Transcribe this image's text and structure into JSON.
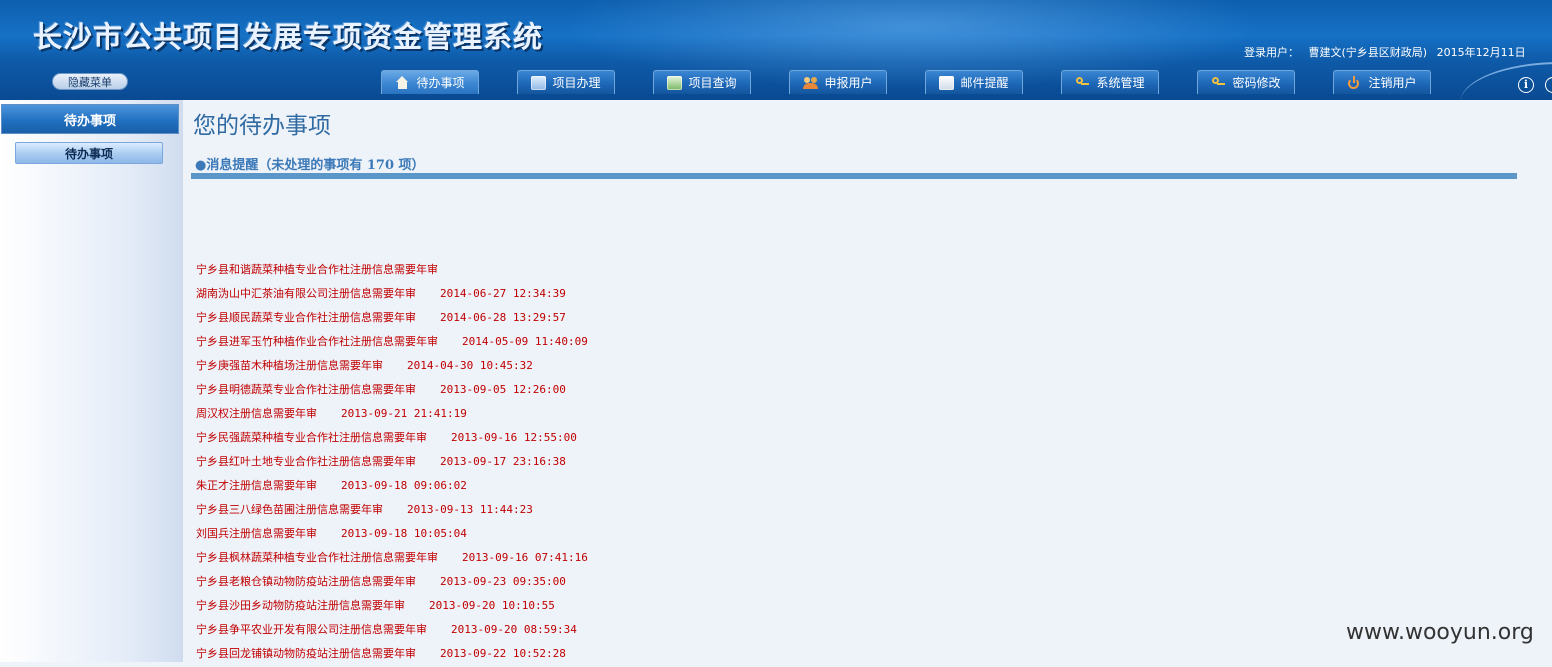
{
  "header": {
    "title": "长沙市公共项目发展专项资金管理系统",
    "user_label": "登录用户：",
    "user_name": "曹建文(宁乡县区财政局)",
    "date": "2015年12月11日"
  },
  "hide_menu_label": "隐藏菜单",
  "tabs": [
    {
      "label": "待办事项",
      "icon": "home-icon"
    },
    {
      "label": "项目办理",
      "icon": "document-icon"
    },
    {
      "label": "项目查询",
      "icon": "table-icon"
    },
    {
      "label": "申报用户",
      "icon": "users-icon"
    },
    {
      "label": "邮件提醒",
      "icon": "mail-icon"
    },
    {
      "label": "系统管理",
      "icon": "keys-icon"
    },
    {
      "label": "密码修改",
      "icon": "keys-icon"
    },
    {
      "label": "注销用户",
      "icon": "power-icon"
    }
  ],
  "sidebar": {
    "header": "待办事项",
    "items": [
      {
        "label": "待办事项"
      }
    ]
  },
  "main": {
    "title": "您的待办事项",
    "notice": "●消息提醒（未处理的事项有 170 项）",
    "messages": [
      {
        "text": "宁乡县和谐蔬菜种植专业合作社注册信息需要年审",
        "time": ""
      },
      {
        "text": "湖南沩山中汇茶油有限公司注册信息需要年审",
        "time": "2014-06-27 12:34:39"
      },
      {
        "text": "宁乡县顺民蔬菜专业合作社注册信息需要年审",
        "time": "2014-06-28 13:29:57"
      },
      {
        "text": "宁乡县进军玉竹种植作业合作社注册信息需要年审",
        "time": "2014-05-09 11:40:09"
      },
      {
        "text": "宁乡庚强苗木种植场注册信息需要年审",
        "time": "2014-04-30 10:45:32"
      },
      {
        "text": "宁乡县明德蔬菜专业合作社注册信息需要年审",
        "time": "2013-09-05 12:26:00"
      },
      {
        "text": "周汉权注册信息需要年审",
        "time": "2013-09-21 21:41:19"
      },
      {
        "text": "宁乡民强蔬菜种植专业合作社注册信息需要年审",
        "time": "2013-09-16 12:55:00"
      },
      {
        "text": "宁乡县红叶土地专业合作社注册信息需要年审",
        "time": "2013-09-17 23:16:38"
      },
      {
        "text": "朱正才注册信息需要年审",
        "time": "2013-09-18 09:06:02"
      },
      {
        "text": "宁乡县三八绿色苗圃注册信息需要年审",
        "time": "2013-09-13 11:44:23"
      },
      {
        "text": "刘国兵注册信息需要年审",
        "time": "2013-09-18 10:05:04"
      },
      {
        "text": "宁乡县枫林蔬菜种植专业合作社注册信息需要年审",
        "time": "2013-09-16 07:41:16"
      },
      {
        "text": "宁乡县老粮仓镇动物防疫站注册信息需要年审",
        "time": "2013-09-23 09:35:00"
      },
      {
        "text": "宁乡县沙田乡动物防疫站注册信息需要年审",
        "time": "2013-09-20 10:10:55"
      },
      {
        "text": "宁乡县争平农业开发有限公司注册信息需要年审",
        "time": "2013-09-20 08:59:34"
      },
      {
        "text": "宁乡县回龙铺镇动物防疫站注册信息需要年审",
        "time": "2013-09-22 10:52:28"
      }
    ]
  },
  "watermark": "www.wooyun.org",
  "colors": {
    "header_blue": "#1671c6",
    "title_blue": "#2f6aa3",
    "notice_bar": "#5b96c9",
    "message_red": "#c00000"
  }
}
